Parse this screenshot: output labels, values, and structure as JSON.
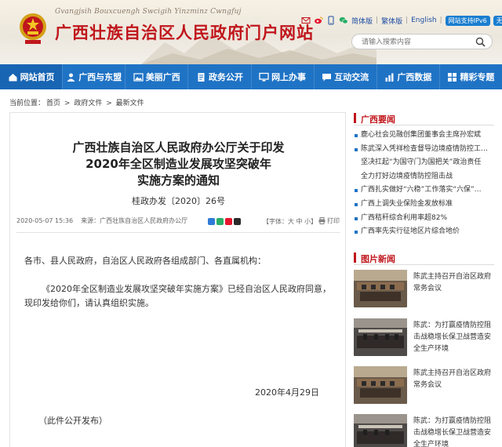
{
  "header": {
    "pinyin": "Gvangjsih Bouxcuengh Swcigih Yinzminz Cwngfuj",
    "site_title": "广西壮族自治区人民政府门户网站",
    "links": {
      "simplified": "简体版",
      "sep1": "|",
      "traditional": "繁体版",
      "sep2": "|",
      "english": "English",
      "sep3": "|",
      "ipv6": "网站支持IPv6",
      "accessible": "无障碍"
    },
    "search_placeholder": "请输入搜索内容"
  },
  "nav": {
    "items": [
      {
        "label": "网站首页",
        "icon": "home-icon"
      },
      {
        "label": "广西与东盟",
        "icon": "people-icon"
      },
      {
        "label": "美丽广西",
        "icon": "image-icon"
      },
      {
        "label": "政务公开",
        "icon": "document-icon"
      },
      {
        "label": "网上办事",
        "icon": "monitor-icon"
      },
      {
        "label": "互动交流",
        "icon": "chat-icon"
      },
      {
        "label": "广西数据",
        "icon": "chart-icon"
      },
      {
        "label": "精彩专题",
        "icon": "grid-icon"
      }
    ]
  },
  "breadcrumb": {
    "prefix": "当前位置：",
    "items": [
      "首页",
      "政府文件",
      "最新文件"
    ],
    "sep": ">"
  },
  "article": {
    "title_line1": "广西壮族自治区人民政府办公厅关于印发",
    "title_line2": "2020年全区制造业发展攻坚突破年",
    "title_line3": "实施方案的通知",
    "doc_number": "桂政办发〔2020〕26号",
    "date_time": "2020-05-07 15:36",
    "source": "来源：广西壮族自治区人民政府办公厅",
    "font_size_label": "【字体：大 中 小】",
    "print_label": "打印",
    "salutation": "各市、县人民政府，自治区人民政府各组成部门、各直属机构：",
    "paragraph": "《2020年全区制造业发展攻坚突破年实施方案》已经自治区人民政府同意，现印发给你们，请认真组织实施。",
    "sign_date": "2020年4月29日",
    "disclosure": "（此件公开发布）"
  },
  "sidebar": {
    "news_heading": "广西要闻",
    "news_items": [
      {
        "text": "鹿心社会见融创集团董事会主席孙宏斌",
        "bullet": true
      },
      {
        "text": "陈武深入凭祥检查督导边境疫情防控工作…",
        "bullet": true
      },
      {
        "text": "坚决扛起“为国守门为国把关”政治责任",
        "bullet": false
      },
      {
        "text": "全力打好边境疫情防控阻击战",
        "bullet": false
      },
      {
        "text": "广西扎实做好“六稳”工作落实“六保”…",
        "bullet": true
      },
      {
        "text": "广西上调失业保险金发放标准",
        "bullet": true
      },
      {
        "text": "广西秸秆综合利用率超82%",
        "bullet": true
      },
      {
        "text": "广西率先实行征地区片综合地价",
        "bullet": true
      }
    ],
    "photo_heading": "图片新闻",
    "photo_items": [
      {
        "caption": "陈武主持召开自治区政府常务会议"
      },
      {
        "caption": "陈武：为打赢疫情防控阻击战稳增长保卫战营造安全生产环境"
      },
      {
        "caption": "陈武主持召开自治区政府常务会议"
      },
      {
        "caption": "陈武：为打赢疫情防控阻击战稳增长保卫战营造安全生产环境"
      }
    ]
  },
  "colors": {
    "brand_red": "#c0161c",
    "nav_blue": "#1f73c5",
    "link_blue": "#1f4ea3"
  }
}
